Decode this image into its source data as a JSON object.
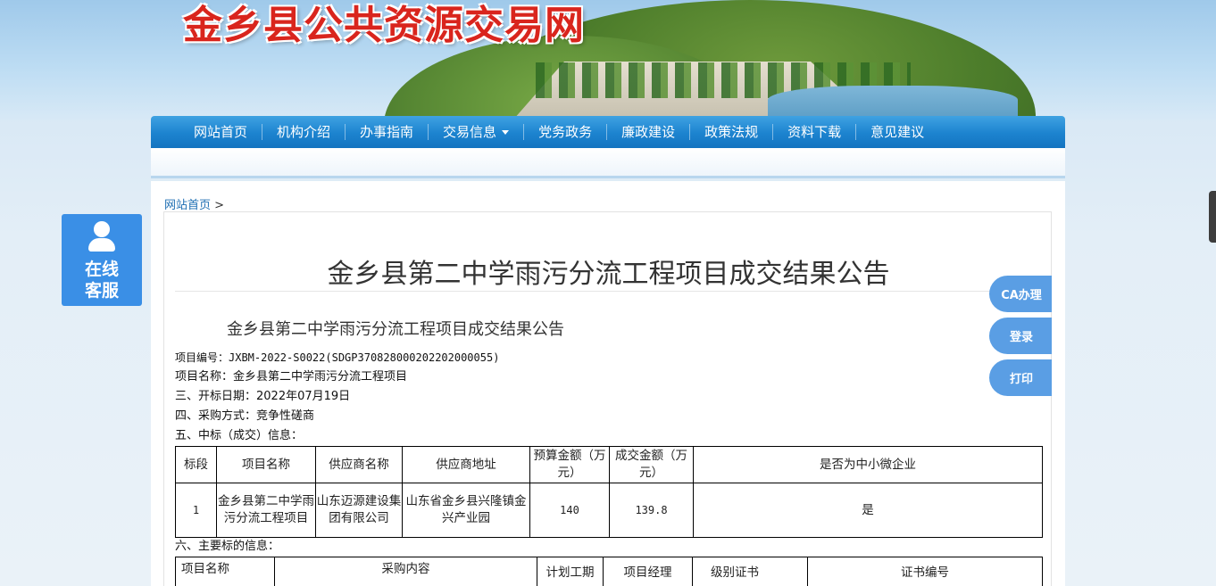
{
  "site": {
    "title": "金乡县公共资源交易网"
  },
  "nav": {
    "items": [
      "网站首页",
      "机构介绍",
      "办事指南",
      "交易信息",
      "党务政务",
      "廉政建设",
      "政策法规",
      "资料下载",
      "意见建议"
    ]
  },
  "breadcrumb": {
    "home": "网站首页",
    "sep": ">"
  },
  "page_title": "金乡县第二中学雨污分流工程项目成交结果公告",
  "doc": {
    "heading": "金乡县第二中学雨污分流工程项目成交结果公告",
    "project_no": "项目编号：JXBM-2022-S0022(SDGP370828000202202000055)",
    "project_name": "项目名称：金乡县第二中学雨污分流工程项目",
    "open_date": "三、开标日期：2022年07月19日",
    "method": "四、采购方式：竞争性磋商",
    "award_title": "五、中标（成交）信息：",
    "award_table": {
      "headers": [
        "标段",
        "项目名称",
        "供应商名称",
        "供应商地址",
        "预算金额（万元）",
        "成交金额（万元）",
        "是否为中小微企业"
      ],
      "rows": [
        [
          "1",
          "金乡县第二中学雨污分流工程项目",
          "山东迈源建设集团有限公司",
          "山东省金乡县兴隆镇金兴产业园",
          "140",
          "139.8",
          "是"
        ]
      ]
    },
    "main_title": "六、主要标的信息：",
    "main_table": {
      "headers": [
        "项目名称",
        "采购内容",
        "计划工期",
        "项目经理",
        "级别证书",
        "证书编号"
      ]
    }
  },
  "widgets": {
    "kefu_line1": "在线",
    "kefu_line2": "客服",
    "side_buttons": [
      "CA办理",
      "登录",
      "打印"
    ]
  }
}
